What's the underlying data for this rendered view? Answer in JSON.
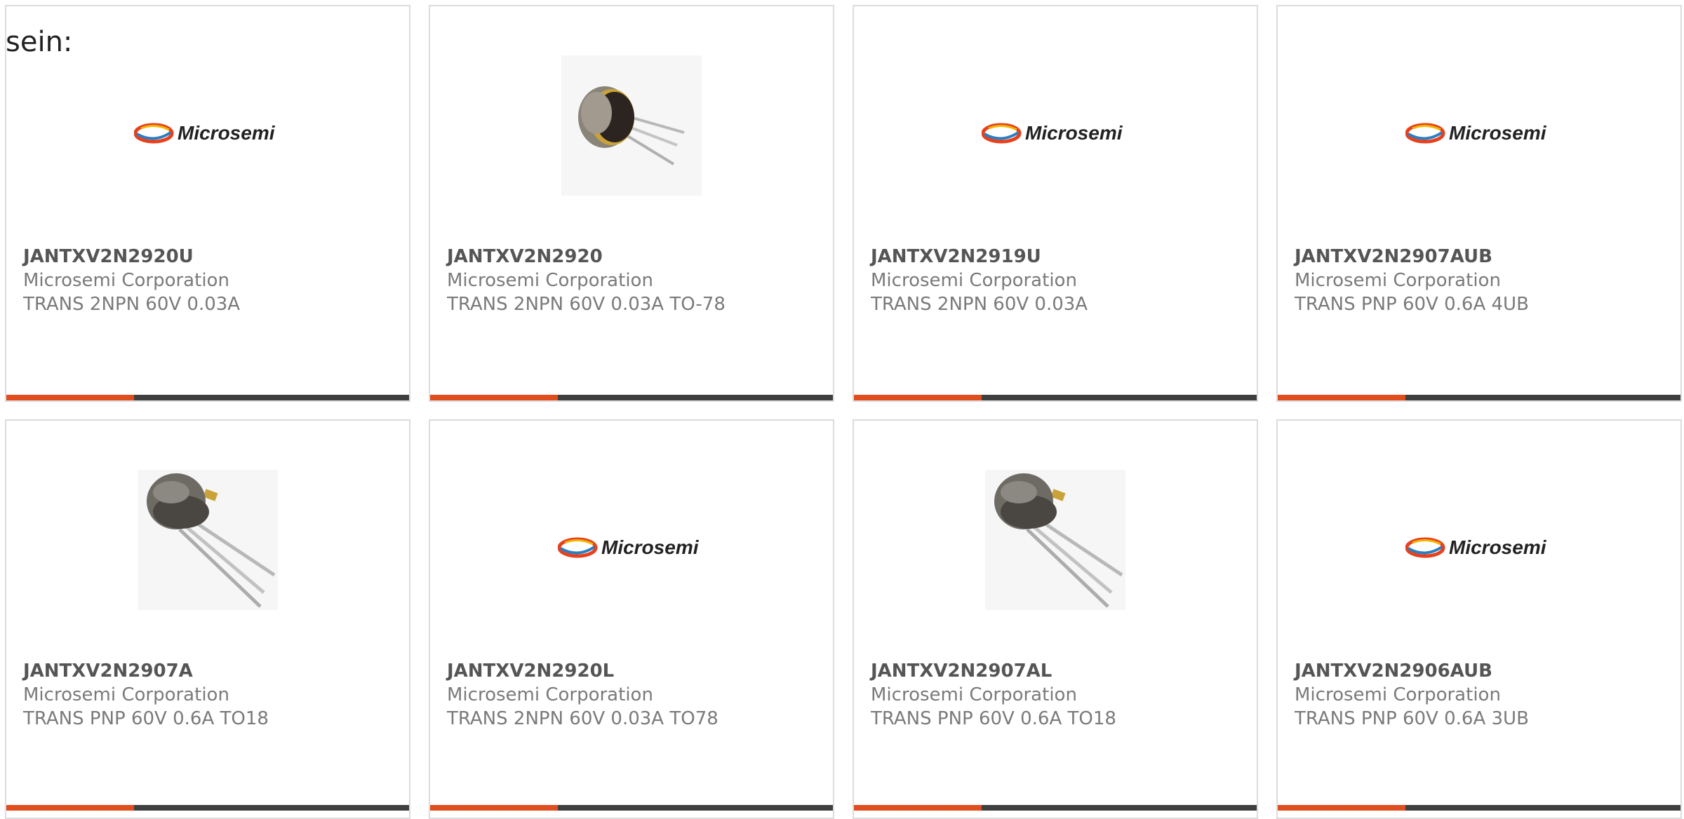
{
  "intro_text": "sein:",
  "brand": {
    "logo_text": "Microsemi",
    "accent_color": "#e04d1f",
    "bar_color": "#3f3f3f"
  },
  "products": [
    {
      "part_number": "JANTXV2N2920U",
      "manufacturer": "Microsemi Corporation",
      "description": "TRANS 2NPN 60V 0.03A",
      "image": "microsemi-logo"
    },
    {
      "part_number": "JANTXV2N2920",
      "manufacturer": "Microsemi Corporation",
      "description": "TRANS 2NPN 60V 0.03A TO-78",
      "image": "to-78-transistor-photo"
    },
    {
      "part_number": "JANTXV2N2919U",
      "manufacturer": "Microsemi Corporation",
      "description": "TRANS 2NPN 60V 0.03A",
      "image": "microsemi-logo"
    },
    {
      "part_number": "JANTXV2N2907AUB",
      "manufacturer": "Microsemi Corporation",
      "description": "TRANS PNP 60V 0.6A 4UB",
      "image": "microsemi-logo"
    },
    {
      "part_number": "JANTXV2N2907A",
      "manufacturer": "Microsemi Corporation",
      "description": "TRANS PNP 60V 0.6A TO18",
      "image": "to-18-transistor-photo"
    },
    {
      "part_number": "JANTXV2N2920L",
      "manufacturer": "Microsemi Corporation",
      "description": "TRANS 2NPN 60V 0.03A TO78",
      "image": "microsemi-logo"
    },
    {
      "part_number": "JANTXV2N2907AL",
      "manufacturer": "Microsemi Corporation",
      "description": "TRANS PNP 60V 0.6A TO18",
      "image": "to-18-transistor-photo"
    },
    {
      "part_number": "JANTXV2N2906AUB",
      "manufacturer": "Microsemi Corporation",
      "description": "TRANS PNP 60V 0.6A 3UB",
      "image": "microsemi-logo"
    }
  ]
}
